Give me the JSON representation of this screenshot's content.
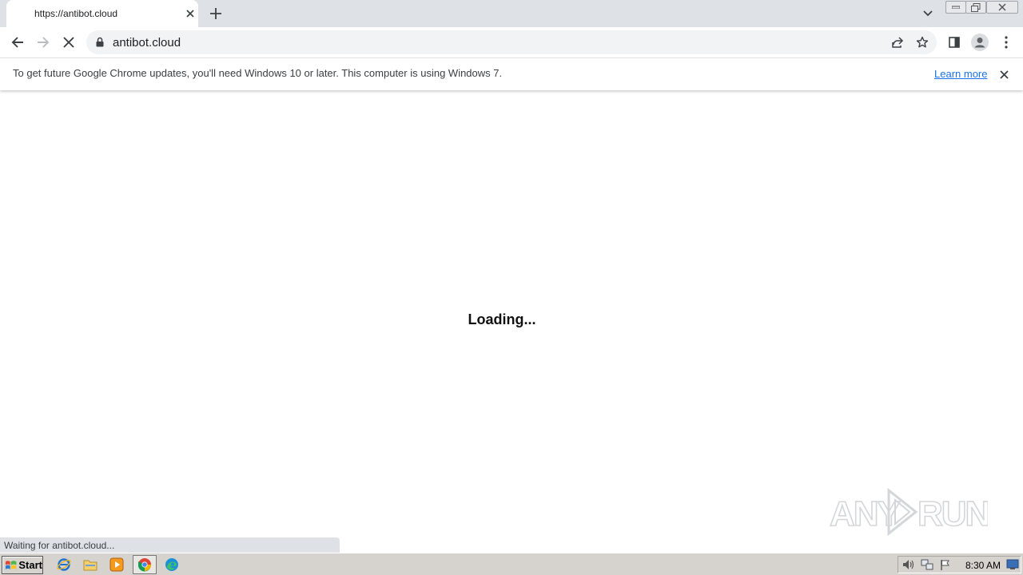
{
  "browser": {
    "tab": {
      "title": "https://antibot.cloud"
    },
    "address_bar": {
      "url": "antibot.cloud"
    }
  },
  "infobar": {
    "message": "To get future Google Chrome updates, you'll need Windows 10 or later. This computer is using Windows 7.",
    "link_label": "Learn more"
  },
  "page": {
    "loading_text": "Loading...",
    "status_text": "Waiting for antibot.cloud..."
  },
  "watermark": {
    "text": "ANY RUN"
  },
  "taskbar": {
    "start_label": "Start",
    "clock": "8:30 AM",
    "apps": [
      "internet-explorer-icon",
      "file-explorer-icon",
      "media-player-icon",
      "chrome-icon",
      "edge-icon"
    ]
  },
  "colors": {
    "accent_link": "#1a73e8",
    "tabstrip_bg": "#dee1e6",
    "taskbar_bg": "#d6d3ce"
  }
}
